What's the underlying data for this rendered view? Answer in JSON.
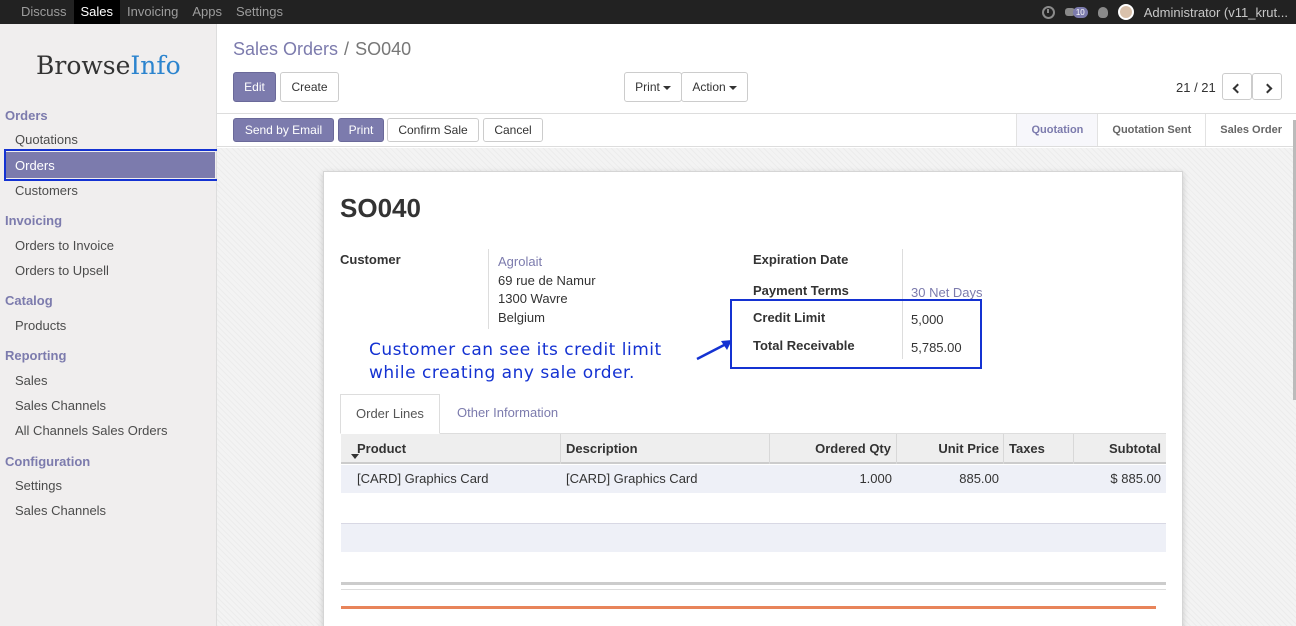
{
  "topbar": {
    "menu": [
      "Discuss",
      "Sales",
      "Invoicing",
      "Apps",
      "Settings"
    ],
    "active": "Sales",
    "chat_count": "10",
    "user": "Administrator (v11_krut..."
  },
  "sidebar": {
    "logo_a": "Browse",
    "logo_b": "Info",
    "sections": [
      {
        "title": "Orders",
        "items": [
          "Quotations",
          "Orders",
          "Customers"
        ]
      },
      {
        "title": "Invoicing",
        "items": [
          "Orders to Invoice",
          "Orders to Upsell"
        ]
      },
      {
        "title": "Catalog",
        "items": [
          "Products"
        ]
      },
      {
        "title": "Reporting",
        "items": [
          "Sales",
          "Sales Channels",
          "All Channels Sales Orders"
        ]
      },
      {
        "title": "Configuration",
        "items": [
          "Settings",
          "Sales Channels"
        ]
      }
    ],
    "active_item": "Orders"
  },
  "breadcrumb": {
    "parent": "Sales Orders",
    "separator": "/",
    "current": "SO040"
  },
  "buttons": {
    "edit": "Edit",
    "create": "Create",
    "print": "Print",
    "action": "Action",
    "send_email": "Send by Email",
    "print2": "Print",
    "confirm": "Confirm Sale",
    "cancel": "Cancel"
  },
  "pager": "21 / 21",
  "stages": [
    "Quotation",
    "Quotation Sent",
    "Sales Order"
  ],
  "current_stage": "Quotation",
  "order": {
    "name": "SO040",
    "customer_label": "Customer",
    "customer_name": "Agrolait",
    "address": [
      "69 rue de Namur",
      "1300 Wavre",
      "Belgium"
    ],
    "expiration_label": "Expiration Date",
    "payment_terms_label": "Payment Terms",
    "payment_terms": "30 Net Days",
    "credit_limit_label": "Credit Limit",
    "credit_limit": "5,000",
    "total_receivable_label": "Total Receivable",
    "total_receivable": "5,785.00"
  },
  "annotation": [
    "Customer can see its credit limit",
    "while creating any sale order."
  ],
  "tabs": [
    "Order Lines",
    "Other Information"
  ],
  "table": {
    "headers": [
      "Product",
      "Description",
      "Ordered Qty",
      "Unit Price",
      "Taxes",
      "Subtotal"
    ],
    "rows": [
      [
        "[CARD] Graphics Card",
        "[CARD] Graphics Card",
        "1.000",
        "885.00",
        "",
        "$ 885.00"
      ]
    ]
  }
}
